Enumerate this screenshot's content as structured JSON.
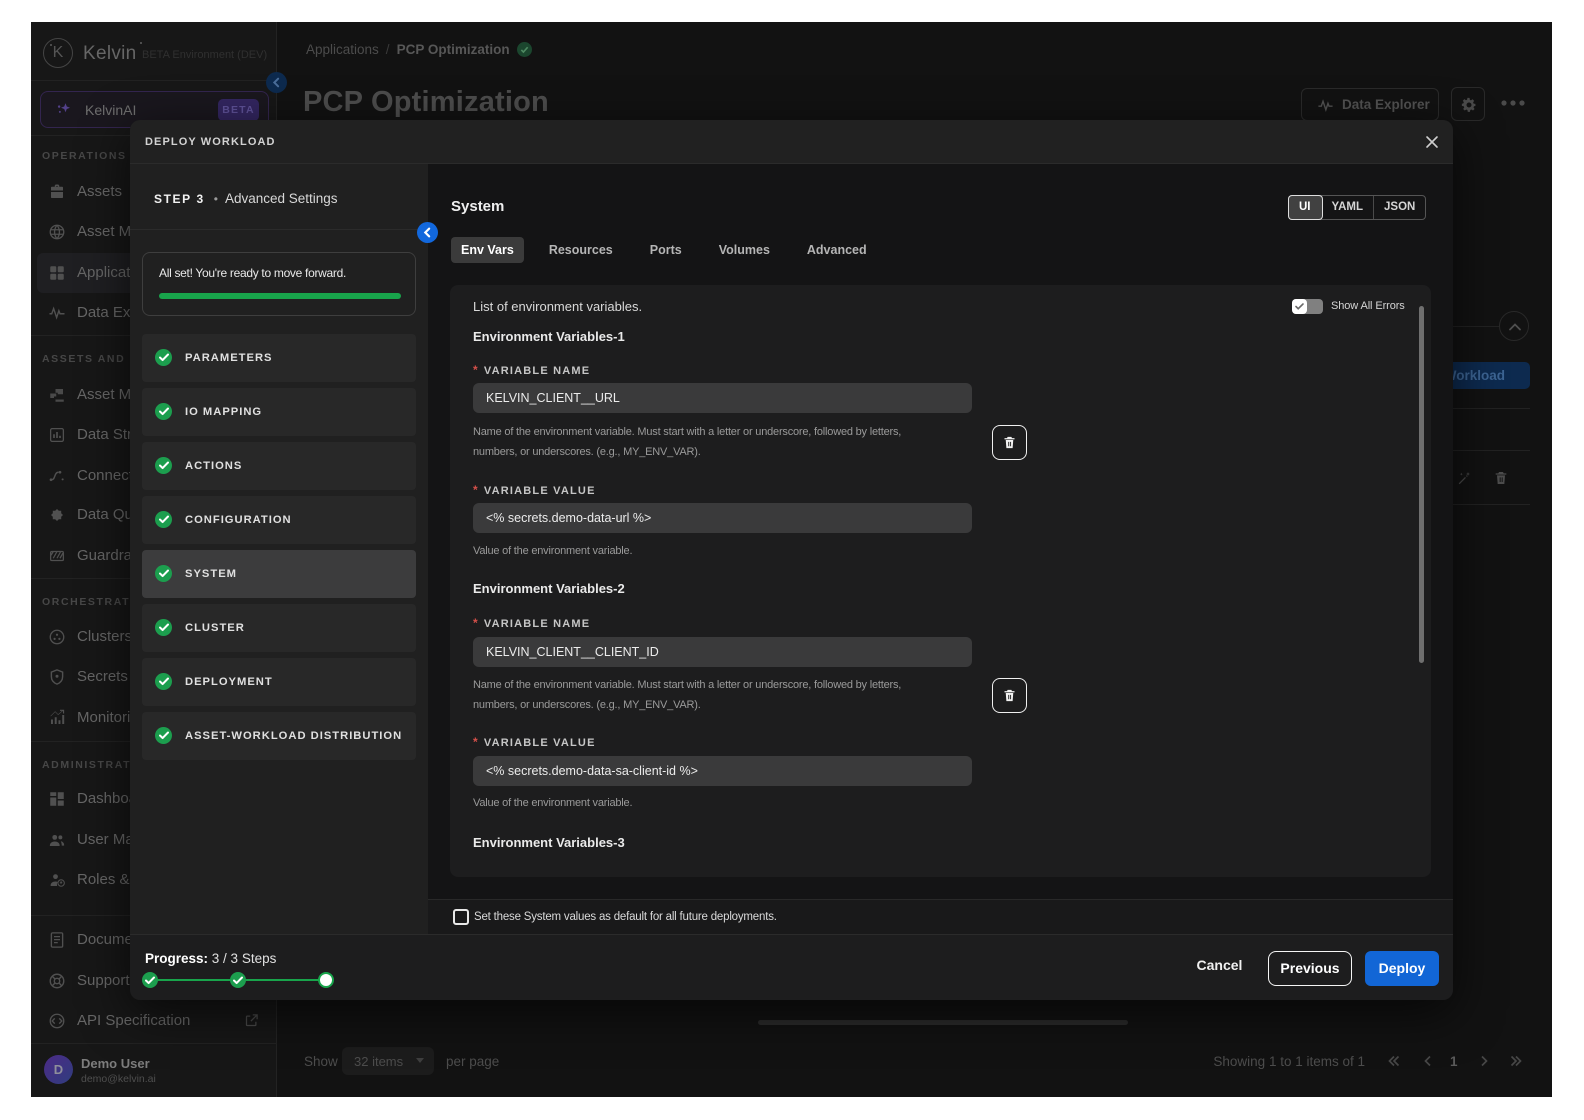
{
  "sidebar": {
    "logo_letter": "K",
    "logo_text": "Kelvin",
    "env_label": "BETA Environment (DEV)",
    "ai_button": {
      "label": "KelvinAI",
      "badge": "BETA"
    },
    "sections": [
      {
        "header": "OPERATIONS",
        "items": [
          {
            "label": "Assets",
            "icon": "assets-icon"
          },
          {
            "label": "Asset Map",
            "icon": "asset-map-icon"
          },
          {
            "label": "Applications",
            "icon": "applications-icon"
          },
          {
            "label": "Data Explorer",
            "icon": "data-explorer-icon"
          }
        ]
      },
      {
        "header": "ASSETS AND DATA",
        "items": [
          {
            "label": "Asset Management",
            "icon": "asset-management-icon"
          },
          {
            "label": "Data Streams",
            "icon": "data-streams-icon"
          },
          {
            "label": "Connections",
            "icon": "connections-icon"
          },
          {
            "label": "Data Quality",
            "icon": "data-quality-icon"
          },
          {
            "label": "Guardrails",
            "icon": "guardrails-icon"
          }
        ]
      },
      {
        "header": "ORCHESTRATION",
        "items": [
          {
            "label": "Clusters",
            "icon": "clusters-icon"
          },
          {
            "label": "Secrets",
            "icon": "secrets-icon"
          },
          {
            "label": "Monitoring",
            "icon": "monitoring-icon"
          }
        ]
      },
      {
        "header": "ADMINISTRATION",
        "items": [
          {
            "label": "Dashboards",
            "icon": "dashboards-icon"
          },
          {
            "label": "User Management",
            "icon": "user-management-icon"
          },
          {
            "label": "Roles & Permissions",
            "icon": "roles-permissions-icon"
          }
        ]
      }
    ],
    "footer_items": [
      {
        "label": "Documentation",
        "icon": "documentation-icon"
      },
      {
        "label": "Support",
        "icon": "support-icon"
      },
      {
        "label": "API Specification",
        "icon": "api-specification-icon"
      }
    ],
    "user": {
      "initial": "D",
      "name": "Demo User",
      "email": "demo@kelvin.ai"
    }
  },
  "header": {
    "breadcrumb": {
      "parent": "Applications",
      "separator": "/",
      "current": "PCP Optimization"
    },
    "title": "PCP Optimization",
    "data_explorer_label": "Data Explorer"
  },
  "background": {
    "deploy_workload_label": "Deploy Workload",
    "show_label": "Show",
    "items_per_page_value": "32 items",
    "per_page_label": "per page",
    "showing_text": "Showing 1 to 1 items of 1",
    "page_number": "1"
  },
  "modal": {
    "title": "DEPLOY WORKLOAD",
    "step_indicator": {
      "step": "STEP 3",
      "bullet": "•",
      "name": "Advanced Settings"
    },
    "status_message": "All set! You're ready to move forward.",
    "steps": [
      {
        "label": "PARAMETERS"
      },
      {
        "label": "IO MAPPING"
      },
      {
        "label": "ACTIONS"
      },
      {
        "label": "CONFIGURATION"
      },
      {
        "label": "SYSTEM"
      },
      {
        "label": "CLUSTER"
      },
      {
        "label": "DEPLOYMENT"
      },
      {
        "label": "ASSET-WORKLOAD DISTRIBUTION"
      }
    ],
    "active_step": "SYSTEM",
    "panel": {
      "title": "System",
      "view_modes": [
        {
          "label": "UI"
        },
        {
          "label": "YAML"
        },
        {
          "label": "JSON"
        }
      ],
      "active_view": "UI",
      "tabs": [
        {
          "label": "Env Vars"
        },
        {
          "label": "Resources"
        },
        {
          "label": "Ports"
        },
        {
          "label": "Volumes"
        },
        {
          "label": "Advanced"
        }
      ],
      "active_tab": "Env Vars",
      "list_label": "List of environment variables.",
      "show_all_errors_label": "Show All Errors",
      "groups": [
        {
          "title": "Environment Variables-1",
          "name_label": "VARIABLE NAME",
          "name_value": "KELVIN_CLIENT__URL",
          "name_help_line1": "Name of the environment variable. Must start with a letter or underscore, followed by letters,",
          "name_help_line2": "numbers, or underscores. (e.g., MY_ENV_VAR).",
          "value_label": "VARIABLE VALUE",
          "value_value": "<% secrets.demo-data-url %>",
          "value_help": "Value of the environment variable."
        },
        {
          "title": "Environment Variables-2",
          "name_label": "VARIABLE NAME",
          "name_value": "KELVIN_CLIENT__CLIENT_ID",
          "name_help_line1": "Name of the environment variable. Must start with a letter or underscore, followed by letters,",
          "name_help_line2": "numbers, or underscores. (e.g., MY_ENV_VAR).",
          "value_label": "VARIABLE VALUE",
          "value_value": "<% secrets.demo-data-sa-client-id %>",
          "value_help": "Value of the environment variable."
        }
      ],
      "next_group_title": "Environment Variables-3",
      "default_checkbox_label": "Set these System values as default for all future deployments."
    },
    "footer": {
      "progress_label": "Progress:",
      "progress_value": "3 / 3 Steps",
      "cancel_label": "Cancel",
      "previous_label": "Previous",
      "deploy_label": "Deploy"
    }
  },
  "colors": {
    "accent_blue": "#1266d6",
    "success_green": "#18a44b",
    "modal_bg": "#141415",
    "panel_bg": "#202020",
    "card_bg": "#1d1d1e",
    "input_bg": "#3a3a3b",
    "sidebar_bg": "#171717",
    "page_bg": "#121212",
    "kelvinai_purple": "#3b2c80",
    "error_red": "#d5504a"
  }
}
